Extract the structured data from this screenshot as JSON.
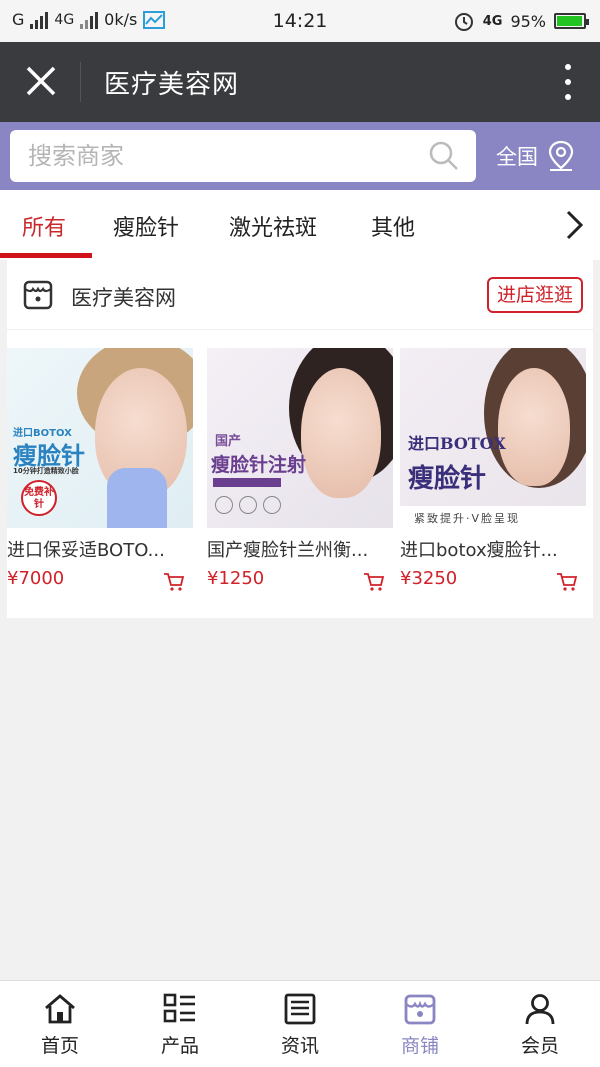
{
  "status_bar": {
    "carrier": "G",
    "network": "4G",
    "speed": "0k/s",
    "time": "14:21",
    "network_right": "4G",
    "battery": "95%",
    "battery_level": 0.95
  },
  "header": {
    "title": "医疗美容网"
  },
  "search": {
    "placeholder": "搜索商家",
    "region": "全国"
  },
  "tabs": [
    {
      "label": "所有",
      "active": true
    },
    {
      "label": "瘦脸针",
      "active": false
    },
    {
      "label": "激光祛斑",
      "active": false
    },
    {
      "label": "其他",
      "active": false
    }
  ],
  "store": {
    "name": "医疗美容网",
    "visit_label": "进店逛逛"
  },
  "products": [
    {
      "name": "进口保妥适BOTO...",
      "price": "¥7000",
      "img_tag": "进口BOTOX",
      "img_title": "瘦脸针",
      "img_sub": "10分钟打造精致小脸",
      "img_badge": "免费补针"
    },
    {
      "name": "国产瘦脸针兰州衡...",
      "price": "¥1250",
      "img_tag": "国产",
      "img_title": "瘦脸针注射"
    },
    {
      "name": "进口botox瘦脸针...",
      "price": "¥3250",
      "img_tag": "进口BOTOX",
      "img_title": "瘦脸针",
      "img_sub": "紧致提升·V脸呈现"
    }
  ],
  "bottom_nav": [
    {
      "label": "首页",
      "icon": "home-icon",
      "active": false
    },
    {
      "label": "产品",
      "icon": "product-list-icon",
      "active": false
    },
    {
      "label": "资讯",
      "icon": "news-icon",
      "active": false
    },
    {
      "label": "商铺",
      "icon": "shop-icon",
      "active": true
    },
    {
      "label": "会员",
      "icon": "member-icon",
      "active": false
    }
  ],
  "colors": {
    "header_bg": "#3a3b3f",
    "search_bg": "#8a86c4",
    "accent_red": "#d0222a",
    "nav_active": "#8a86c4"
  }
}
